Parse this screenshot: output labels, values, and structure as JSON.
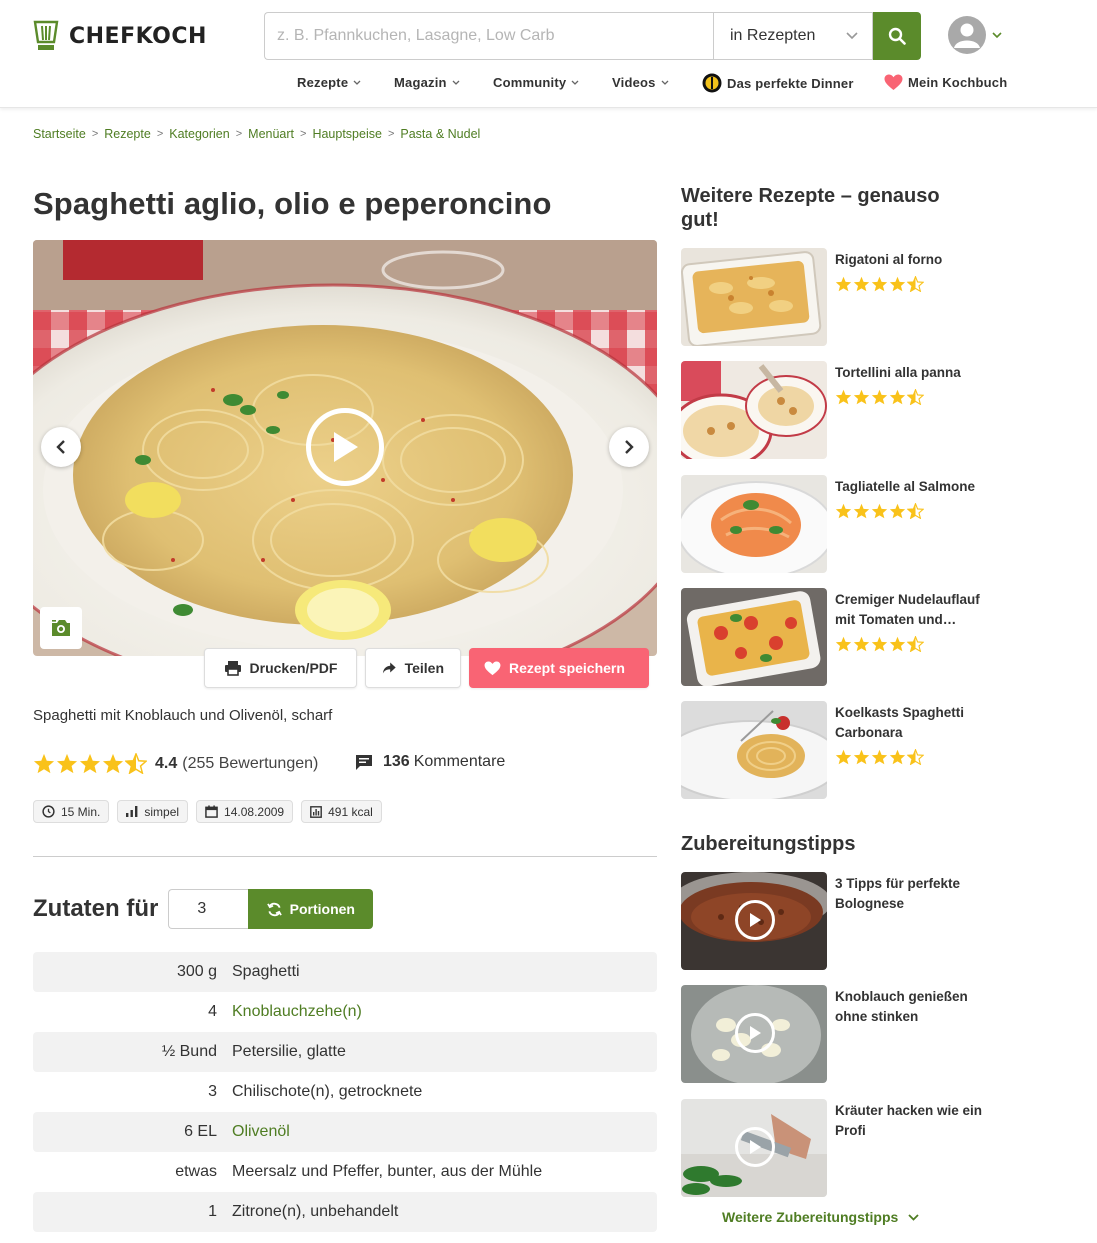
{
  "header": {
    "logo_text": "CHEFKOCH",
    "search_placeholder": "z. B. Pfannkuchen, Lasagne, Low Carb",
    "search_scope": "in Rezepten",
    "nav": [
      "Rezepte",
      "Magazin",
      "Community",
      "Videos",
      "Das perfekte Dinner",
      "Mein Kochbuch"
    ]
  },
  "breadcrumb": [
    "Startseite",
    "Rezepte",
    "Kategorien",
    "Menüart",
    "Hauptspeise",
    "Pasta & Nudel"
  ],
  "recipe": {
    "title": "Spaghetti aglio, olio e peperoncino",
    "subtitle": "Spaghetti mit Knoblauch und Olivenöl, scharf",
    "rating": "4.4",
    "rating_count": "(255 Bewertungen)",
    "comments_count": "136",
    "comments_label": "Kommentare",
    "actions": {
      "print": "Drucken/PDF",
      "share": "Teilen",
      "save": "Rezept speichern"
    },
    "tags": {
      "time": "15 Min.",
      "difficulty": "simpel",
      "date": "14.08.2009",
      "calories": "491 kcal"
    },
    "ingredients_label": "Zutaten für",
    "portions": "3",
    "portions_button": "Portionen",
    "ingredients": [
      {
        "amount": "300 g",
        "name": "Spaghetti"
      },
      {
        "amount": "4",
        "name": "Knoblauchzehe(n)"
      },
      {
        "amount": "½ Bund",
        "name": "Petersilie, glatte"
      },
      {
        "amount": "3",
        "name": "Chilischote(n), getrocknete"
      },
      {
        "amount": "6 EL",
        "name": "Olivenöl"
      },
      {
        "amount": "etwas",
        "name": "Meersalz und Pfeffer, bunter, aus der Mühle"
      },
      {
        "amount": "1",
        "name": "Zitrone(n), unbehandelt"
      }
    ]
  },
  "sidebar": {
    "more_recipes_title": "Weitere Rezepte – genauso gut!",
    "recipes": [
      {
        "title": "Rigatoni al forno"
      },
      {
        "title": "Tortellini alla panna"
      },
      {
        "title": "Tagliatelle al Salmone"
      },
      {
        "title": "Cremiger Nudelauflauf mit Tomaten und…"
      },
      {
        "title": "Koelkasts Spaghetti Carbonara"
      }
    ],
    "tips_title": "Zubereitungstipps",
    "tips": [
      {
        "title": "3 Tipps für perfekte Bolognese"
      },
      {
        "title": "Knoblauch genießen ohne stinken"
      },
      {
        "title": "Kräuter hacken wie ein Profi"
      }
    ],
    "more_tips": "Weitere Zubereitungstipps"
  },
  "colors": {
    "brand_green": "#5b8b2b",
    "link_green": "#4f7d23",
    "save_red": "#f96474",
    "star": "#f9c21a"
  }
}
